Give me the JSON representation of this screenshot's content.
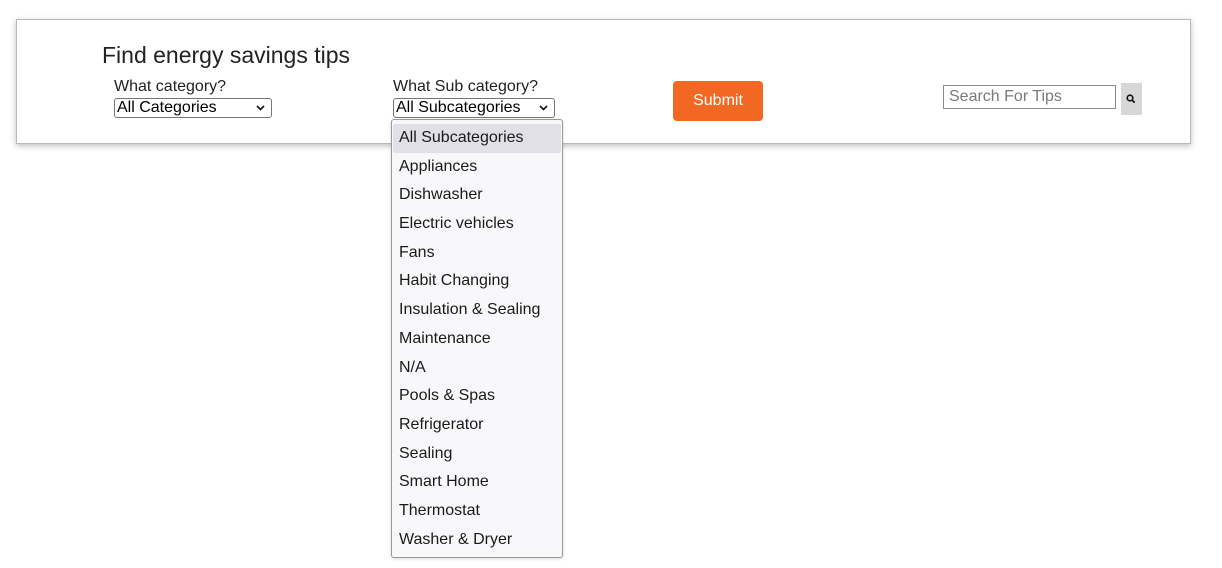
{
  "panel": {
    "title": "Find energy savings tips",
    "category": {
      "label": "What category?",
      "selected": "All Categories"
    },
    "subcategory": {
      "label": "What Sub category?",
      "selected": "All Subcategories",
      "options": [
        "All Subcategories",
        "Appliances",
        "Dishwasher",
        "Electric vehicles",
        "Fans",
        "Habit Changing",
        "Insulation & Sealing",
        "Maintenance",
        "N/A",
        "Pools & Spas",
        "Refrigerator",
        "Sealing",
        "Smart Home",
        "Thermostat",
        "Washer & Dryer"
      ]
    },
    "submit_label": "Submit",
    "search": {
      "placeholder": "Search For Tips",
      "icon": "search-icon"
    }
  },
  "colors": {
    "accent": "#f26722",
    "highlight": "#e0e0e6"
  }
}
